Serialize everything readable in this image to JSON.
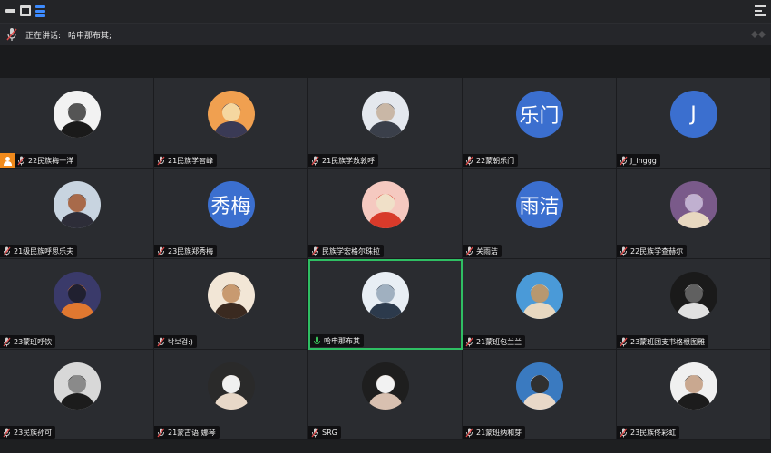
{
  "titlebar": {
    "icons": [
      "minimize-icon",
      "window-icon",
      "layers-icon",
      "menu-icon"
    ],
    "accent": "#3d8bff"
  },
  "speaking": {
    "label": "正在讲话:",
    "speaker": "哈申那布其;"
  },
  "colors": {
    "tile_bg": "#2a2c30",
    "avatar_text_bg": "#3b6fcf",
    "active_border": "#2fbf63",
    "host_badge": "#f08a1c",
    "mic_muted": "#e04848"
  },
  "participants": [
    {
      "name": "22民族梅一洋",
      "avatar_text": "",
      "avatar": "photo",
      "host": true,
      "active": false,
      "mic": "muted"
    },
    {
      "name": "21民族学智峰",
      "avatar_text": "",
      "avatar": "photo",
      "host": false,
      "active": false,
      "mic": "muted"
    },
    {
      "name": "21民族学敖敦呼",
      "avatar_text": "",
      "avatar": "photo",
      "host": false,
      "active": false,
      "mic": "muted"
    },
    {
      "name": "22蒙朝乐门",
      "avatar_text": "乐门",
      "avatar": "text",
      "host": false,
      "active": false,
      "mic": "muted"
    },
    {
      "name": "J_inggg",
      "avatar_text": "J",
      "avatar": "text",
      "host": false,
      "active": false,
      "mic": "muted"
    },
    {
      "name": "21级民族呼思乐夫",
      "avatar_text": "",
      "avatar": "photo",
      "host": false,
      "active": false,
      "mic": "muted"
    },
    {
      "name": "23民族郑秀梅",
      "avatar_text": "秀梅",
      "avatar": "text",
      "host": false,
      "active": false,
      "mic": "muted"
    },
    {
      "name": "民族学宏格尔珠拉",
      "avatar_text": "",
      "avatar": "photo",
      "host": false,
      "active": false,
      "mic": "muted"
    },
    {
      "name": "关雨洁",
      "avatar_text": "雨洁",
      "avatar": "text",
      "host": false,
      "active": false,
      "mic": "muted"
    },
    {
      "name": "22民族学查赫尔",
      "avatar_text": "",
      "avatar": "photo",
      "host": false,
      "active": false,
      "mic": "muted"
    },
    {
      "name": "23蒙班呼饮",
      "avatar_text": "",
      "avatar": "photo",
      "host": false,
      "active": false,
      "mic": "muted"
    },
    {
      "name": "박보검:)",
      "avatar_text": "",
      "avatar": "photo",
      "host": false,
      "active": false,
      "mic": "muted"
    },
    {
      "name": "哈申那布其",
      "avatar_text": "",
      "avatar": "photo",
      "host": false,
      "active": true,
      "mic": "on"
    },
    {
      "name": "21蒙班包兰兰",
      "avatar_text": "",
      "avatar": "photo",
      "host": false,
      "active": false,
      "mic": "muted"
    },
    {
      "name": "23蒙班团支书格根图雅",
      "avatar_text": "",
      "avatar": "photo",
      "host": false,
      "active": false,
      "mic": "muted"
    },
    {
      "name": "23民族孙可",
      "avatar_text": "",
      "avatar": "photo",
      "host": false,
      "active": false,
      "mic": "muted"
    },
    {
      "name": "21蒙古语 娜琴",
      "avatar_text": "",
      "avatar": "photo",
      "host": false,
      "active": false,
      "mic": "muted"
    },
    {
      "name": "SRG",
      "avatar_text": "",
      "avatar": "photo",
      "host": false,
      "active": false,
      "mic": "muted"
    },
    {
      "name": "21蒙班纳和芽",
      "avatar_text": "",
      "avatar": "photo",
      "host": false,
      "active": false,
      "mic": "muted"
    },
    {
      "name": "23民族佟彩虹",
      "avatar_text": "",
      "avatar": "photo",
      "host": false,
      "active": false,
      "mic": "muted"
    }
  ]
}
